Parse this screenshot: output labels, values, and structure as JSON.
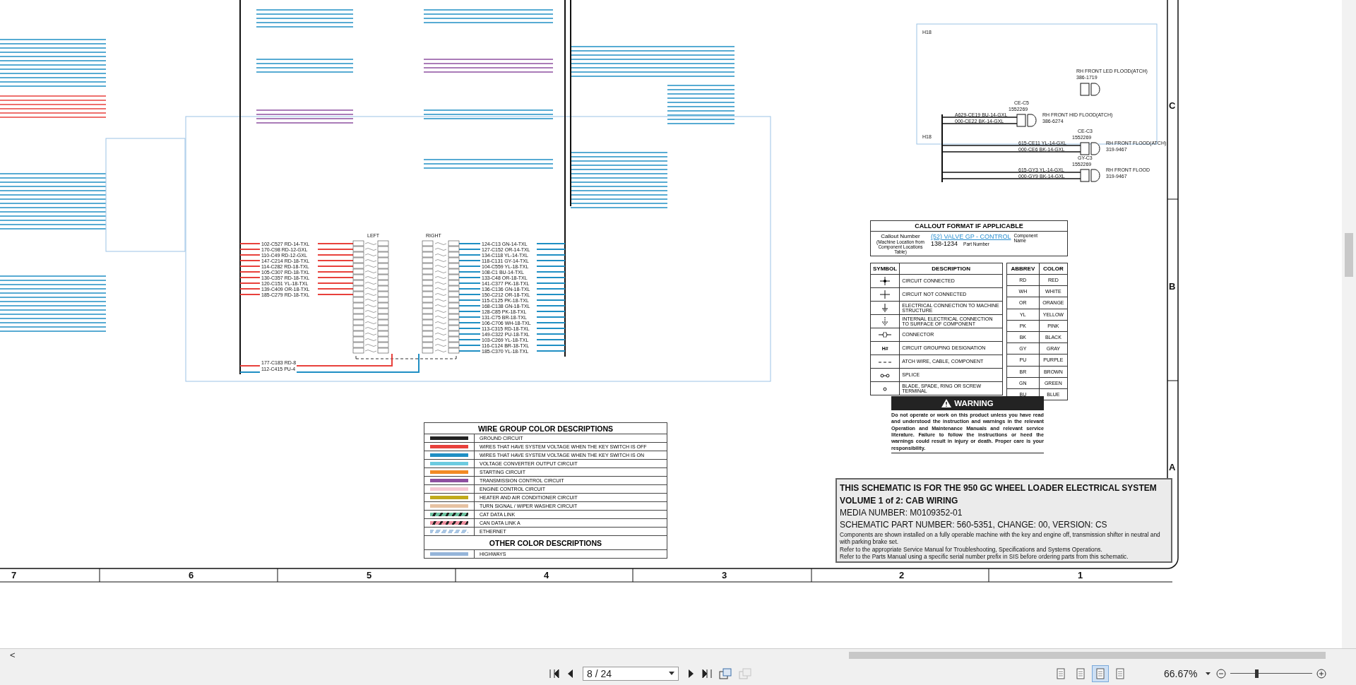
{
  "sheet": {
    "zones": [
      "H18",
      "H18"
    ],
    "fuse_panel": {
      "left_label": "LEFT",
      "right_label": "RIGHT",
      "left_wires": [
        {
          "text": "102-C527 RD-14-TXL",
          "color": "#e8413c"
        },
        {
          "text": "170-C98 RD-12-GXL",
          "color": "#e8413c"
        },
        {
          "text": "110-C49 RD-12-GXL",
          "color": "#e8413c"
        },
        {
          "text": "147-C214 RD-18-TXL",
          "color": "#e8413c"
        },
        {
          "text": "114-C282 RD-18-TXL",
          "color": "#e8413c"
        },
        {
          "text": "105-C307 RD-18-TXL",
          "color": "#e8413c"
        },
        {
          "text": "130-C357 RD-18-TXL",
          "color": "#e8413c"
        },
        {
          "text": "120-C151 YL-18-TXL",
          "color": "#e8413c"
        },
        {
          "text": "139-C409 OR-18-TXL",
          "color": "#e8413c"
        },
        {
          "text": "185-C279 RD-18-TXL",
          "color": "#e8413c"
        }
      ],
      "right_wires": [
        {
          "text": "124-C13 GN-14-TXL",
          "color": "#1f8fc4"
        },
        {
          "text": "127-C152 OR-14-TXL",
          "color": "#1f8fc4"
        },
        {
          "text": "134-C118 YL-14-TXL",
          "color": "#1f8fc4"
        },
        {
          "text": "118-C131 GY-14-TXL",
          "color": "#1f8fc4"
        },
        {
          "text": "104-C559 YL-18-TXL",
          "color": "#1f8fc4"
        },
        {
          "text": "108-C1 BU-14-TXL",
          "color": "#1f8fc4"
        },
        {
          "text": "133-C48 OR-18-TXL",
          "color": "#1f8fc4"
        },
        {
          "text": "141-C377 PK-18-TXL",
          "color": "#1f8fc4"
        },
        {
          "text": "136-C136 GN-18-TXL",
          "color": "#1f8fc4"
        },
        {
          "text": "150-C212 OR-18-TXL",
          "color": "#1f8fc4"
        },
        {
          "text": "115-C125 PK-18-TXL",
          "color": "#1f8fc4"
        },
        {
          "text": "168-C138 GN-18-TXL",
          "color": "#1f8fc4"
        },
        {
          "text": "128-C85 PK-18-TXL",
          "color": "#1f8fc4"
        },
        {
          "text": "131-C75 BR-18-TXL",
          "color": "#1f8fc4"
        },
        {
          "text": "106-C706 WH-18-TXL",
          "color": "#1f8fc4"
        },
        {
          "text": "113-C315 RD-18-TXL",
          "color": "#1f8fc4"
        },
        {
          "text": "149-C322 PU-18-TXL",
          "color": "#1f8fc4"
        },
        {
          "text": "103-C269 YL-18-TXL",
          "color": "#1f8fc4"
        },
        {
          "text": "116-C124 BR-18-TXL",
          "color": "#1f8fc4"
        },
        {
          "text": "185-C370 YL-18-TXL",
          "color": "#1f8fc4"
        }
      ],
      "feed_wires": [
        {
          "text": "177-C183 RD-8",
          "color": "#e8413c"
        },
        {
          "text": "112-C415 PU-4",
          "color": "#1f8fc4"
        }
      ]
    },
    "lamps": [
      {
        "connector": "CE-C5",
        "connector_part": "1552269",
        "name": "RH FRONT HID FLOOD(ATCH)",
        "part": "386-6274",
        "wires": [
          "A629-CE19 BU-14-GXL",
          "000-CE22 BK-14-GXL"
        ]
      },
      {
        "connector": "CE-C3",
        "connector_part": "1552269",
        "name": "RH FRONT FLOOD(ATCH)",
        "part": "319-9467",
        "wires": [
          "615-CE11 YL-14-GXL",
          "000-CE6 BK-14-GXL"
        ]
      },
      {
        "connector": "GY-C3",
        "connector_part": "1552269",
        "name": "RH FRONT FLOOD",
        "part": "319-9467",
        "wires": [
          "615-GY3 YL-14-GXL",
          "000-GY9 BK-14-GXL"
        ]
      }
    ],
    "led_lamp": {
      "name": "RH FRONT LED FLOOD(ATCH)",
      "part": "386-1719"
    },
    "callout": {
      "title": "CALLOUT FORMAT IF APPLICABLE",
      "number_label": "Callout Number",
      "number_note": "(Machine Location from Component Locations Table)",
      "link": "(52) VALVE GP - CONTROL",
      "part": "138-1234",
      "part_label": "Part Number",
      "name_label": "Component Name"
    },
    "symbols": {
      "columns": [
        "SYMBOL",
        "DESCRIPTION"
      ],
      "rows": [
        {
          "kind": "connected",
          "description": "CIRCUIT CONNECTED"
        },
        {
          "kind": "not_connected",
          "description": "CIRCUIT NOT CONNECTED"
        },
        {
          "kind": "ground",
          "description": "ELECTRICAL CONNECTION TO MACHINE STRUCTURE"
        },
        {
          "kind": "internal_ground",
          "description": "INTERNAL ELECTRICAL CONNECTION TO SURFACE OF COMPONENT"
        },
        {
          "kind": "connector",
          "description": "CONNECTOR"
        },
        {
          "kind": "text",
          "symbol": "H#",
          "description": "CIRCUIT GROUPING DESIGNATION"
        },
        {
          "kind": "dashed",
          "description": "ATCH WIRE, CABLE, COMPONENT"
        },
        {
          "kind": "splice",
          "description": "SPLICE"
        },
        {
          "kind": "terminal",
          "description": "BLADE, SPADE, RING OR SCREW TERMINAL"
        }
      ]
    },
    "abbreviations": {
      "columns": [
        "ABBREV",
        "COLOR"
      ],
      "rows": [
        [
          "RD",
          "RED"
        ],
        [
          "WH",
          "WHITE"
        ],
        [
          "OR",
          "ORANGE"
        ],
        [
          "YL",
          "YELLOW"
        ],
        [
          "PK",
          "PINK"
        ],
        [
          "BK",
          "BLACK"
        ],
        [
          "GY",
          "GRAY"
        ],
        [
          "PU",
          "PURPLE"
        ],
        [
          "BR",
          "BROWN"
        ],
        [
          "GN",
          "GREEN"
        ],
        [
          "BU",
          "BLUE"
        ]
      ]
    },
    "warning": {
      "title": "WARNING",
      "text": "Do not operate or work on this product unless you have read and understood the instruction and warnings in the relevant Operation and Maintenance Manuals and relevant service literature. Failure to follow the instructions or heed the warnings could result in injury or death. Proper care is your responsibility."
    },
    "wire_groups": {
      "title": "WIRE GROUP COLOR DESCRIPTIONS",
      "items": [
        {
          "kind": "solid",
          "color": "#222222",
          "label": "GROUND CIRCUIT"
        },
        {
          "kind": "solid",
          "color": "#e8413c",
          "label": "WIRES THAT HAVE SYSTEM VOLTAGE WHEN THE KEY SWITCH IS OFF"
        },
        {
          "kind": "solid",
          "color": "#1f8fc4",
          "label": "WIRES THAT HAVE SYSTEM VOLTAGE WHEN THE KEY SWITCH IS ON"
        },
        {
          "kind": "solid",
          "color": "#6ccbe0",
          "label": "VOLTAGE CONVERTER OUTPUT CIRCUIT"
        },
        {
          "kind": "solid",
          "color": "#f28a25",
          "label": "STARTING CIRCUIT"
        },
        {
          "kind": "solid",
          "color": "#8e4fa0",
          "label": "TRANSMISSION CONTROL CIRCUIT"
        },
        {
          "kind": "solid",
          "color": "#f6c7d4",
          "label": "ENGINE CONTROL CIRCUIT"
        },
        {
          "kind": "solid",
          "color": "#c1aa1c",
          "label": "HEATER AND AIR CONDITIONER CIRCUIT"
        },
        {
          "kind": "solid",
          "color": "#e6c2a2",
          "label": "TURN SIGNAL / WIPER WASHER CIRCUIT"
        },
        {
          "kind": "striped",
          "color": "#6fc3a2",
          "label": "CAT DATA LINK"
        },
        {
          "kind": "striped",
          "color": "#ee8f9f",
          "label": "CAN DATA LINK A"
        },
        {
          "kind": "striped_light",
          "color": "#a9c6e3",
          "label": "ETHERNET"
        }
      ],
      "other_title": "OTHER COLOR DESCRIPTIONS",
      "other_items": [
        {
          "kind": "solid",
          "color": "#94b4d9",
          "label": "HIGHWAYS"
        }
      ]
    },
    "title_block": {
      "lines": [
        "THIS SCHEMATIC IS FOR THE 950 GC WHEEL LOADER ELECTRICAL SYSTEM",
        "VOLUME 1 of 2: CAB WIRING"
      ],
      "media": "MEDIA NUMBER: M0109352-01",
      "part": "SCHEMATIC PART NUMBER: 560-5351, CHANGE: 00, VERSION: CS",
      "notes": [
        "Components are shown installed on a fully operable machine with the key and engine off, transmission shifter in neutral and with parking brake set.",
        "Refer to the appropriate Service Manual for Troubleshooting, Specifications and Systems Operations.",
        "Refer to the Parts Manual using a specific serial number prefix in SIS before ordering parts from this schematic."
      ]
    },
    "columns": [
      "7",
      "6",
      "5",
      "4",
      "3",
      "2",
      "1"
    ],
    "rows": [
      "C",
      "B",
      "A"
    ]
  },
  "toolbar": {
    "scroll_left": "<",
    "page": "8 / 24",
    "zoom": "66.67%",
    "zoom_slider": {
      "level": 0.32
    },
    "views": [
      {
        "selected": false
      },
      {
        "selected": false
      },
      {
        "selected": true
      },
      {
        "selected": false
      }
    ]
  }
}
